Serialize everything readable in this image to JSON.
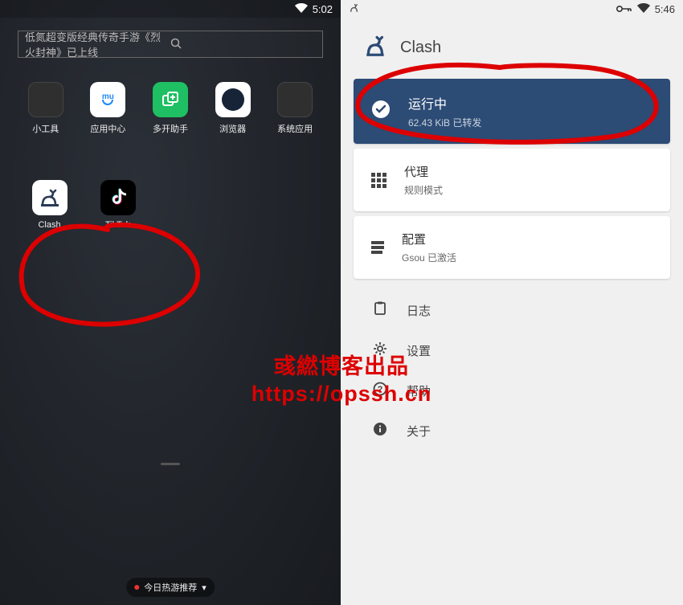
{
  "left": {
    "statusbar": {
      "time": "5:02"
    },
    "search_placeholder": "低氮超变版经典传奇手游《烈火封神》已上线",
    "apps_row1": [
      {
        "label": "小工具"
      },
      {
        "label": "应用中心"
      },
      {
        "label": "多开助手"
      },
      {
        "label": "浏览器"
      },
      {
        "label": "系统应用"
      }
    ],
    "apps_row2": [
      {
        "label": "Clash"
      },
      {
        "label": "TikTok"
      }
    ],
    "hot_label": "今日热游推荐"
  },
  "right": {
    "statusbar": {
      "time": "5:46"
    },
    "app_title": "Clash",
    "running": {
      "title": "运行中",
      "sub": "62.43 KiB 已转发"
    },
    "proxy": {
      "title": "代理",
      "sub": "规则模式"
    },
    "config": {
      "title": "配置",
      "sub": "Gsou 已激活"
    },
    "menu": {
      "log": "日志",
      "settings": "设置",
      "help": "帮助",
      "about": "关于"
    }
  },
  "watermark": {
    "line1": "彧繎博客出品",
    "line2": "https://opssh.cn"
  }
}
